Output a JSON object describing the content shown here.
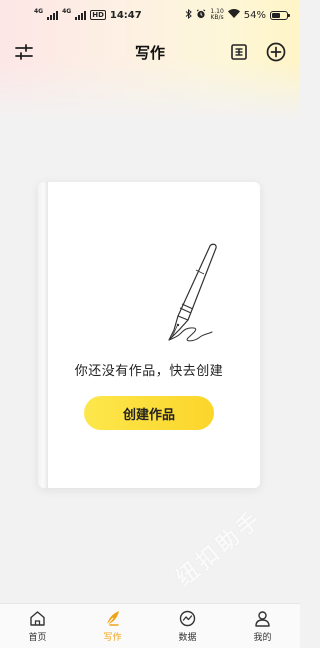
{
  "status_bar": {
    "signal_1": "4G",
    "signal_2": "4G",
    "hd": "HD",
    "time": "14:47",
    "speed_value": "1.10",
    "speed_unit": "KB/s",
    "battery": "54%"
  },
  "header": {
    "title": "写作",
    "left_icon": "sliders-icon",
    "right_icons": [
      "template-icon",
      "add-circle-icon"
    ]
  },
  "empty_state": {
    "illustration": "fountain-pen-icon",
    "message": "你还没有作品，快去创建",
    "button_label": "创建作品"
  },
  "watermark": "纽扣助手",
  "bottom_nav": {
    "items": [
      {
        "label": "首页",
        "icon": "home-icon",
        "active": false
      },
      {
        "label": "写作",
        "icon": "quill-icon",
        "active": true
      },
      {
        "label": "数据",
        "icon": "chart-icon",
        "active": false
      },
      {
        "label": "我的",
        "icon": "profile-icon",
        "active": false
      }
    ]
  },
  "colors": {
    "accent": "#f0a31a",
    "button_yellow": "#fcd52a",
    "background": "#f2f2f2"
  }
}
